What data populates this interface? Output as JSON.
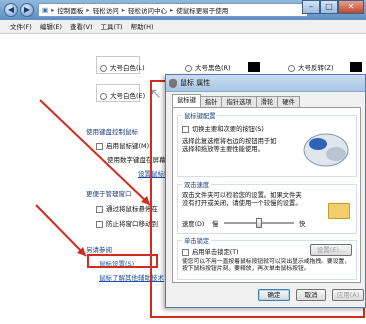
{
  "control_panel": {
    "address_path": [
      "控制面板",
      "轻松访问",
      "轻松访问中心",
      "使鼠标更易于使用"
    ],
    "menu": [
      "文件(F)",
      "编辑(E)",
      "查看(V)",
      "工具(T)",
      "帮助(H)"
    ],
    "pointer_options": [
      "大号白色(L)",
      "大号黑色(R)",
      "大号反转(Z)",
      "大号白色(E)"
    ],
    "keyboard_control_title": "使用键盘控制鼠标",
    "mouse_keys_label": "启用鼠标键(M)",
    "mouse_keys_setup_partial": "使用数字键盘在屏幕",
    "mouse_keys_setup_link": "设置鼠标键(Y)",
    "window_mgmt_title": "更便于管理窗口",
    "hover_activate_partial": "通过将鼠标悬停在",
    "prevent_arrange_partial": "防止将窗口移动到",
    "see_also_title": "另请参阅",
    "mouse_settings_link": "鼠标设置(S)",
    "learn_more_link": "鼠标了解其他辅助技术"
  },
  "dialog": {
    "title": "鼠标 属性",
    "tabs": [
      "鼠标键",
      "指针",
      "指针选项",
      "滑轮",
      "硬件"
    ],
    "button_config_title": "鼠标键配置",
    "switch_buttons_label": "切换主要和次要的按钮(S)",
    "switch_desc": "选择此复选框将右边的按钮用于如选择和拖放等主要性能使用。",
    "double_click_title": "双击速度",
    "double_click_desc": "双击文件夹可以检验您的设置。如果文件夹没有打开或关闭，请使用一个较慢的设置。",
    "speed_label": "速度(D)",
    "slow_label": "慢",
    "fast_label": "快",
    "click_lock_title": "单击锁定",
    "click_lock_label": "启用单击锁定(T)",
    "click_lock_settings": "设置(E)...",
    "click_lock_desc": "使您可以不用一直按着鼠标按钮就可以突出显示或拖拽。要设置，按下鼠标按钮片刻。要释放，再次单击鼠标按钮。",
    "ok": "确定",
    "cancel": "取消",
    "apply": "应用(A)"
  },
  "colors": {
    "accent_red": "#d22b1f",
    "link_blue": "#1a4fa0"
  }
}
